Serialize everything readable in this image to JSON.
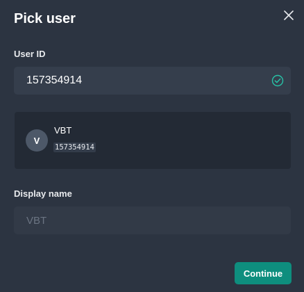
{
  "dialog": {
    "title": "Pick user",
    "close_icon": "close-icon"
  },
  "user_id_field": {
    "label": "User ID",
    "value": "157354914",
    "status_icon": "check-circle-icon",
    "status_color": "#27c2a7"
  },
  "user_card": {
    "avatar_initial": "V",
    "name": "VBT",
    "user_id": "157354914"
  },
  "display_name_field": {
    "label": "Display name",
    "placeholder": "VBT"
  },
  "actions": {
    "continue_label": "Continue",
    "continue_color": "#0e8e7e"
  }
}
